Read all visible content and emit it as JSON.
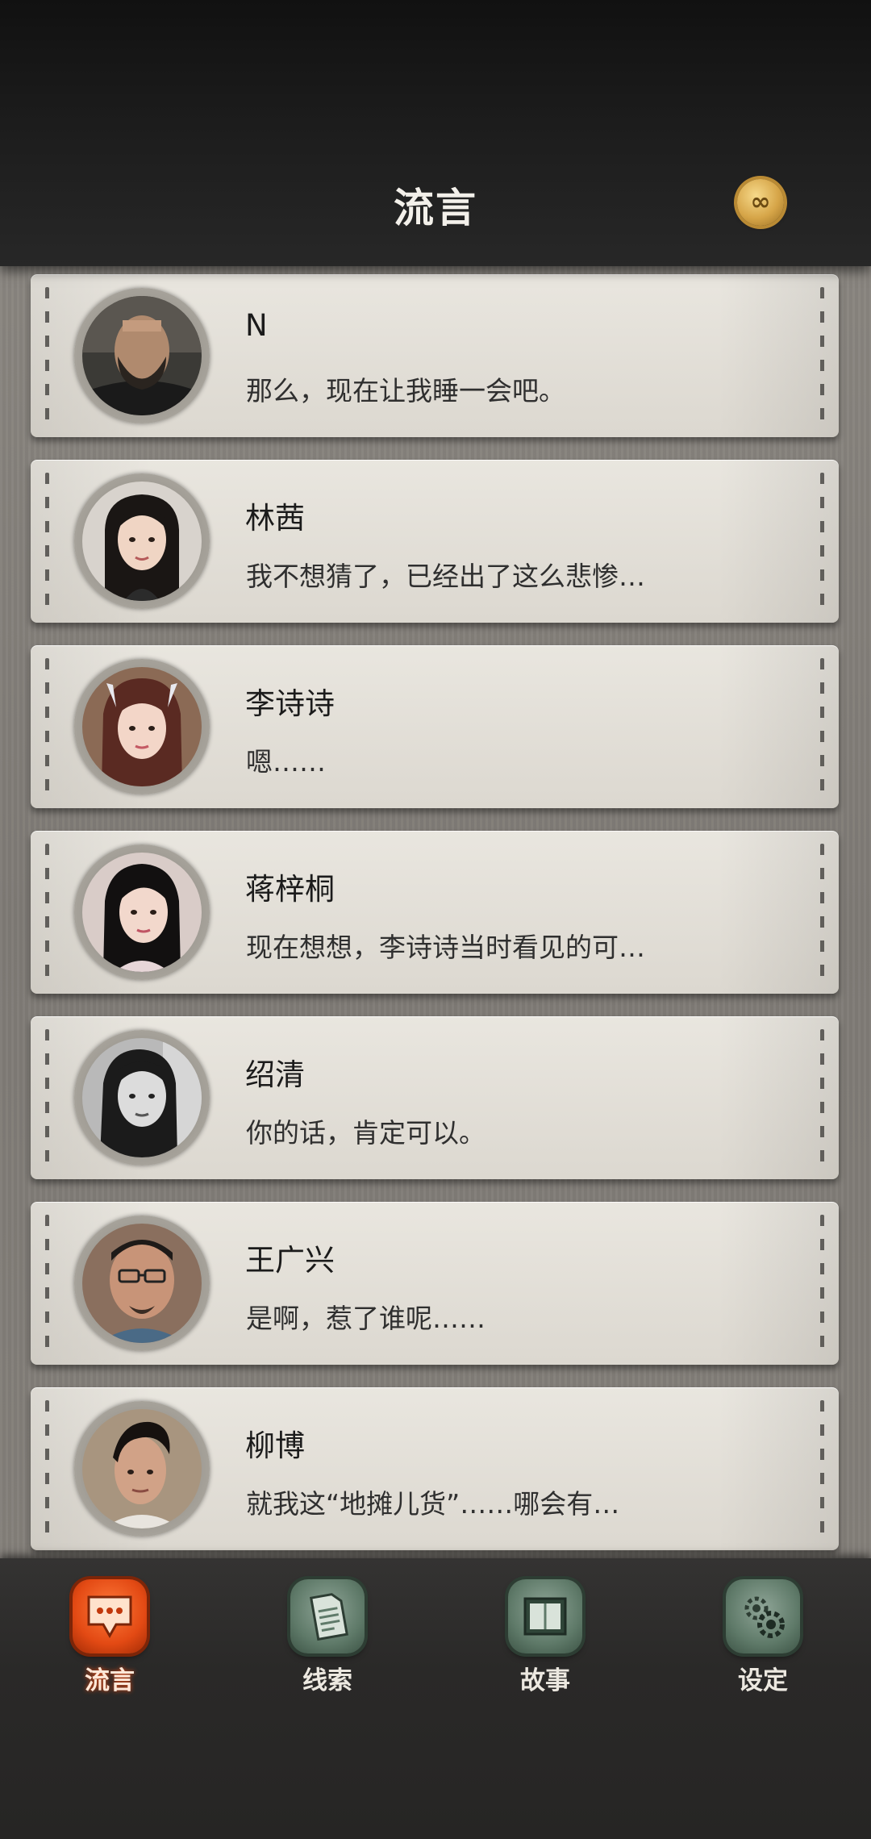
{
  "header": {
    "title": "流言",
    "coin_icon": "infinity-coin-icon",
    "coin_symbol": "∞"
  },
  "contacts": [
    {
      "name": "N",
      "message": "那么，现在让我睡一会吧。",
      "avatar_icon": "avatar-man-beard"
    },
    {
      "name": "林茜",
      "message": "我不想猜了，已经出了这么悲惨…",
      "avatar_icon": "avatar-woman-long-hair"
    },
    {
      "name": "李诗诗",
      "message": "嗯……",
      "avatar_icon": "avatar-woman-auburn-hair"
    },
    {
      "name": "蒋梓桐",
      "message": "现在想想，李诗诗当时看见的可…",
      "avatar_icon": "avatar-woman-black-hair"
    },
    {
      "name": "绍清",
      "message": "你的话，肯定可以。",
      "avatar_icon": "avatar-woman-grayscale"
    },
    {
      "name": "王广兴",
      "message": "是啊，惹了谁呢……",
      "avatar_icon": "avatar-man-glasses"
    },
    {
      "name": "柳博",
      "message": "就我这“地摊儿货”……哪会有…",
      "avatar_icon": "avatar-man-short-hair"
    }
  ],
  "nav": {
    "items": [
      {
        "label": "流言",
        "icon": "chat-bubble-icon",
        "active": true
      },
      {
        "label": "线索",
        "icon": "document-icon",
        "active": false
      },
      {
        "label": "故事",
        "icon": "book-icon",
        "active": false
      },
      {
        "label": "设定",
        "icon": "gears-icon",
        "active": false
      }
    ]
  },
  "colors": {
    "accent_active": "#e34a14",
    "nav_idle": "#5f7a69",
    "header_bg": "#1e1e1e",
    "card_bg": "#e2dfd8"
  }
}
